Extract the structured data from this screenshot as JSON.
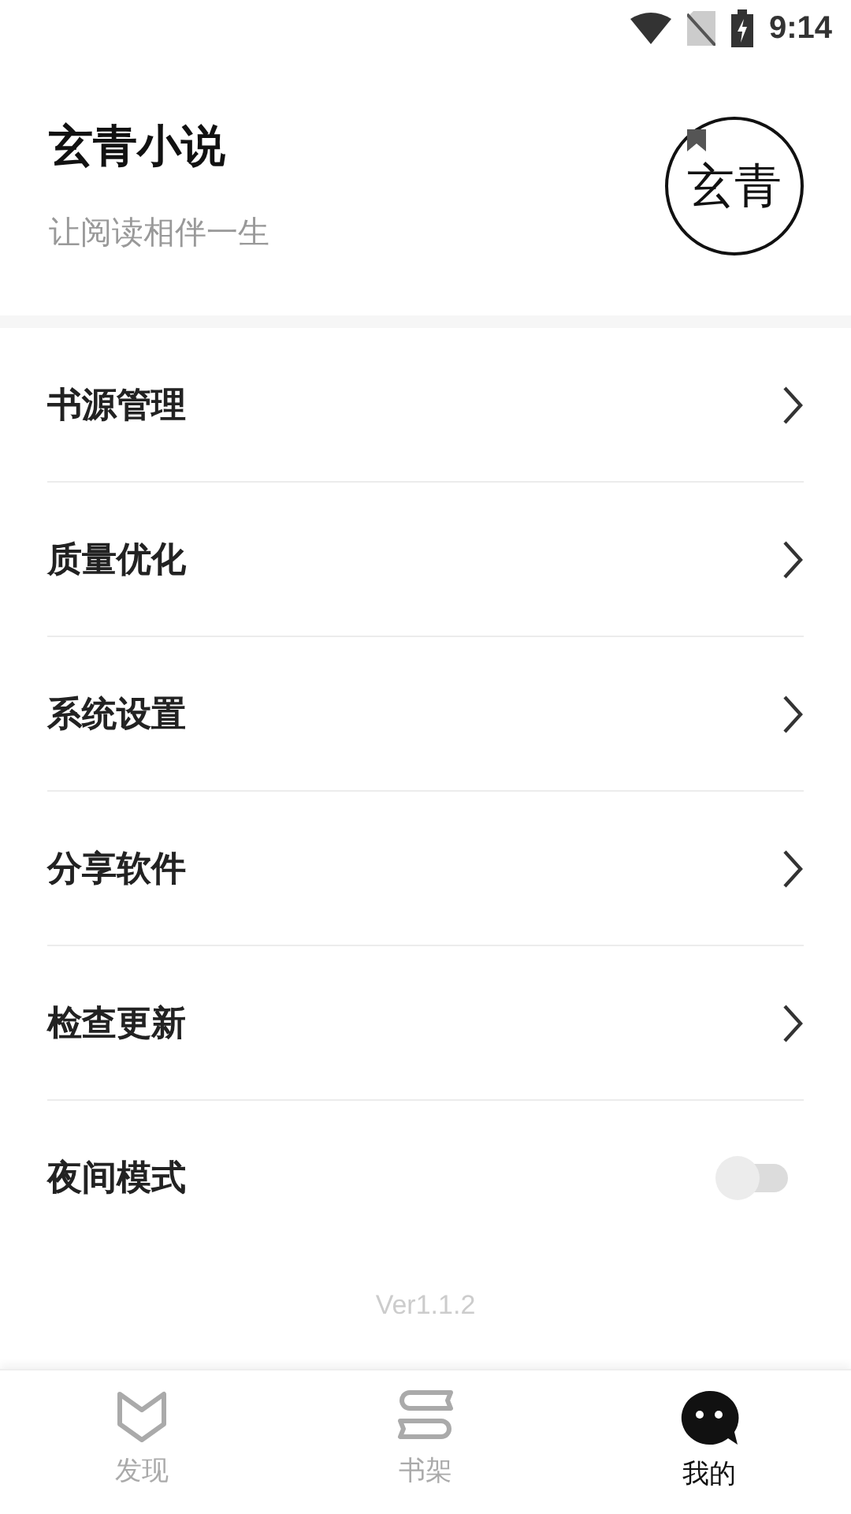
{
  "status_bar": {
    "time": "9:14"
  },
  "header": {
    "title": "玄青小说",
    "subtitle": "让阅读相伴一生",
    "logo_text": "玄青"
  },
  "menu": [
    {
      "kind": "link",
      "label": "书源管理"
    },
    {
      "kind": "link",
      "label": "质量优化"
    },
    {
      "kind": "link",
      "label": "系统设置"
    },
    {
      "kind": "link",
      "label": "分享软件"
    },
    {
      "kind": "link",
      "label": "检查更新"
    },
    {
      "kind": "toggle",
      "label": "夜间模式",
      "on": false
    }
  ],
  "version": "Ver1.1.2",
  "tabs": [
    {
      "kind": "discover",
      "label": "发现",
      "selected": false
    },
    {
      "kind": "shelf",
      "label": "书架",
      "selected": false
    },
    {
      "kind": "me",
      "label": "我的",
      "selected": true
    }
  ]
}
